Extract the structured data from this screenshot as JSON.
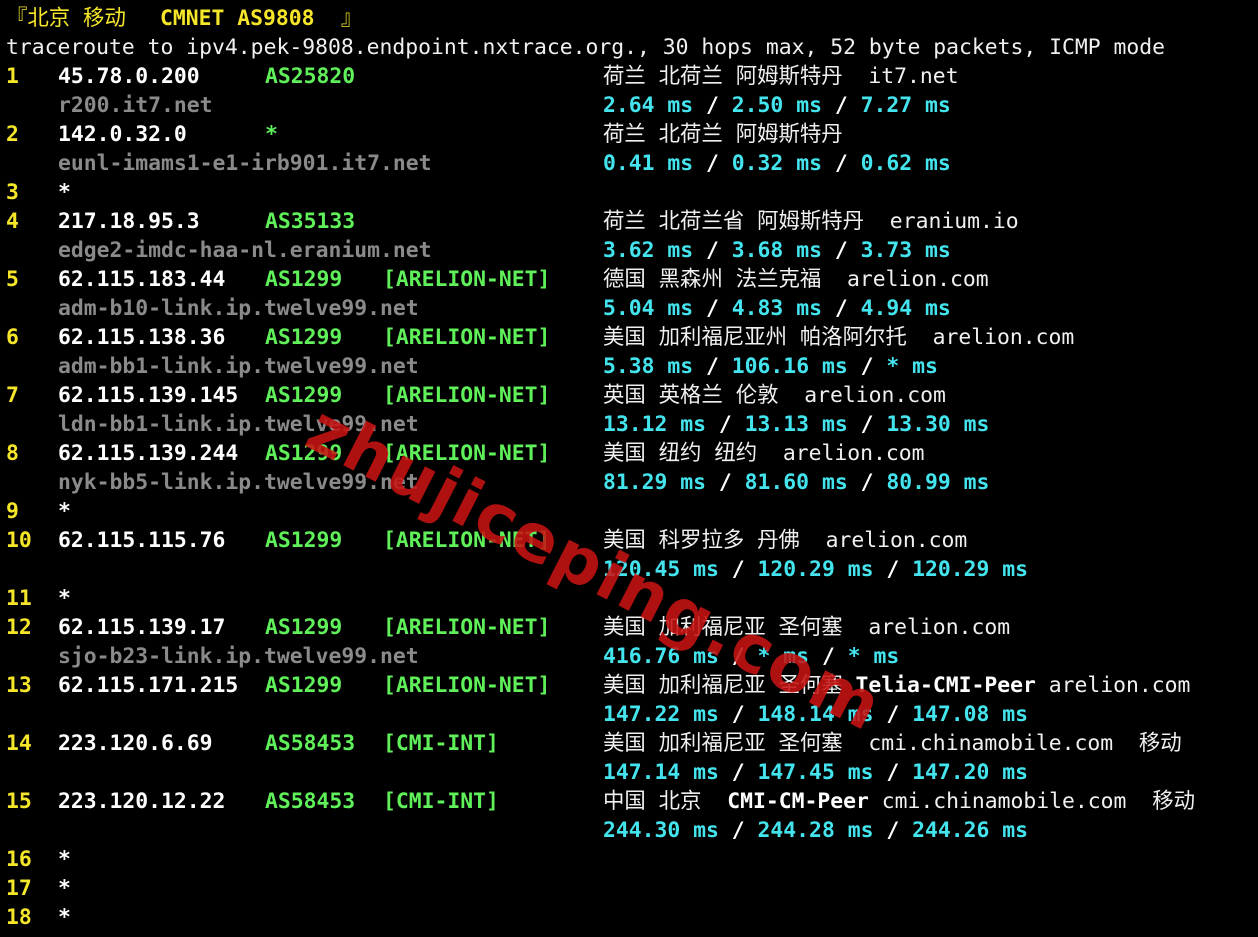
{
  "header": {
    "title_prefix": "『北京 移动 ",
    "title_bold": "CMNET AS9808",
    "title_suffix": " 』",
    "command": "traceroute to ipv4.pek-9808.endpoint.nxtrace.org., 30 hops max, 52 byte packets, ICMP mode"
  },
  "hops": [
    {
      "num": "1",
      "ip": "45.78.0.200",
      "asn": "AS25820",
      "tag": "",
      "geo": "荷兰 北荷兰 阿姆斯特丹  it7.net",
      "host": "r200.it7.net",
      "rtt": [
        "2.64 ms",
        "2.50 ms",
        "7.27 ms"
      ]
    },
    {
      "num": "2",
      "ip": "142.0.32.0",
      "asn": "*",
      "tag": "",
      "geo": "荷兰 北荷兰 阿姆斯特丹",
      "host": "eunl-imams1-e1-irb901.it7.net",
      "rtt": [
        "0.41 ms",
        "0.32 ms",
        "0.62 ms"
      ]
    },
    {
      "num": "3",
      "star": "*"
    },
    {
      "num": "4",
      "ip": "217.18.95.3",
      "asn": "AS35133",
      "tag": "",
      "geo": "荷兰 北荷兰省 阿姆斯特丹  eranium.io",
      "host": "edge2-imdc-haa-nl.eranium.net",
      "rtt": [
        "3.62 ms",
        "3.68 ms",
        "3.73 ms"
      ]
    },
    {
      "num": "5",
      "ip": "62.115.183.44",
      "asn": "AS1299",
      "tag": "[ARELION-NET]",
      "geo": "德国 黑森州 法兰克福  arelion.com",
      "host": "adm-b10-link.ip.twelve99.net",
      "rtt": [
        "5.04 ms",
        "4.83 ms",
        "4.94 ms"
      ]
    },
    {
      "num": "6",
      "ip": "62.115.138.36",
      "asn": "AS1299",
      "tag": "[ARELION-NET]",
      "geo": "美国 加利福尼亚州 帕洛阿尔托  arelion.com",
      "host": "adm-bb1-link.ip.twelve99.net",
      "rtt": [
        "5.38 ms",
        "106.16 ms",
        "* ms"
      ]
    },
    {
      "num": "7",
      "ip": "62.115.139.145",
      "asn": "AS1299",
      "tag": "[ARELION-NET]",
      "geo": "英国 英格兰 伦敦  arelion.com",
      "host": "ldn-bb1-link.ip.twelve99.net",
      "rtt": [
        "13.12 ms",
        "13.13 ms",
        "13.30 ms"
      ]
    },
    {
      "num": "8",
      "ip": "62.115.139.244",
      "asn": "AS1299",
      "tag": "[ARELION-NET]",
      "geo": "美国 纽约 纽约  arelion.com",
      "host": "nyk-bb5-link.ip.twelve99.net",
      "rtt": [
        "81.29 ms",
        "81.60 ms",
        "80.99 ms"
      ]
    },
    {
      "num": "9",
      "star": "*"
    },
    {
      "num": "10",
      "ip": "62.115.115.76",
      "asn": "AS1299",
      "tag": "[ARELION-NET]",
      "geo": "美国 科罗拉多 丹佛  arelion.com",
      "host": "",
      "rtt": [
        "120.45 ms",
        "120.29 ms",
        "120.29 ms"
      ]
    },
    {
      "num": "11",
      "star": "*"
    },
    {
      "num": "12",
      "ip": "62.115.139.17",
      "asn": "AS1299",
      "tag": "[ARELION-NET]",
      "geo": "美国 加利福尼亚 圣何塞  arelion.com",
      "host": "sjo-b23-link.ip.twelve99.net",
      "rtt": [
        "416.76 ms",
        "* ms",
        "* ms"
      ]
    },
    {
      "num": "13",
      "ip": "62.115.171.215",
      "asn": "AS1299",
      "tag": "[ARELION-NET]",
      "geo": "美国 加利福尼亚 圣何塞 ",
      "geo_bold": "Telia-CMI-Peer",
      "geo_tail": " arelion.com",
      "host": "",
      "rtt": [
        "147.22 ms",
        "148.14 ms",
        "147.08 ms"
      ]
    },
    {
      "num": "14",
      "ip": "223.120.6.69",
      "asn": "AS58453",
      "tag": "[CMI-INT]",
      "geo": "美国 加利福尼亚 圣何塞  cmi.chinamobile.com  移动",
      "host": "",
      "rtt": [
        "147.14 ms",
        "147.45 ms",
        "147.20 ms"
      ]
    },
    {
      "num": "15",
      "ip": "223.120.12.22",
      "asn": "AS58453",
      "tag": "[CMI-INT]",
      "geo": "中国 北京  ",
      "geo_bold": "CMI-CM-Peer",
      "geo_tail": " cmi.chinamobile.com  移动",
      "host": "",
      "rtt": [
        "244.30 ms",
        "244.28 ms",
        "244.26 ms"
      ]
    },
    {
      "num": "16",
      "star": "*"
    },
    {
      "num": "17",
      "star": "*"
    },
    {
      "num": "18",
      "star": "*"
    }
  ],
  "watermark": "zhujiceping.com",
  "colors": {
    "hop_number": "#f5e62a",
    "ip": "#ffffff",
    "asn": "#5ff05a",
    "hostname": "#8a8a8a",
    "rtt": "#44e4ee",
    "watermark": "#c81414",
    "background": "#000000"
  }
}
